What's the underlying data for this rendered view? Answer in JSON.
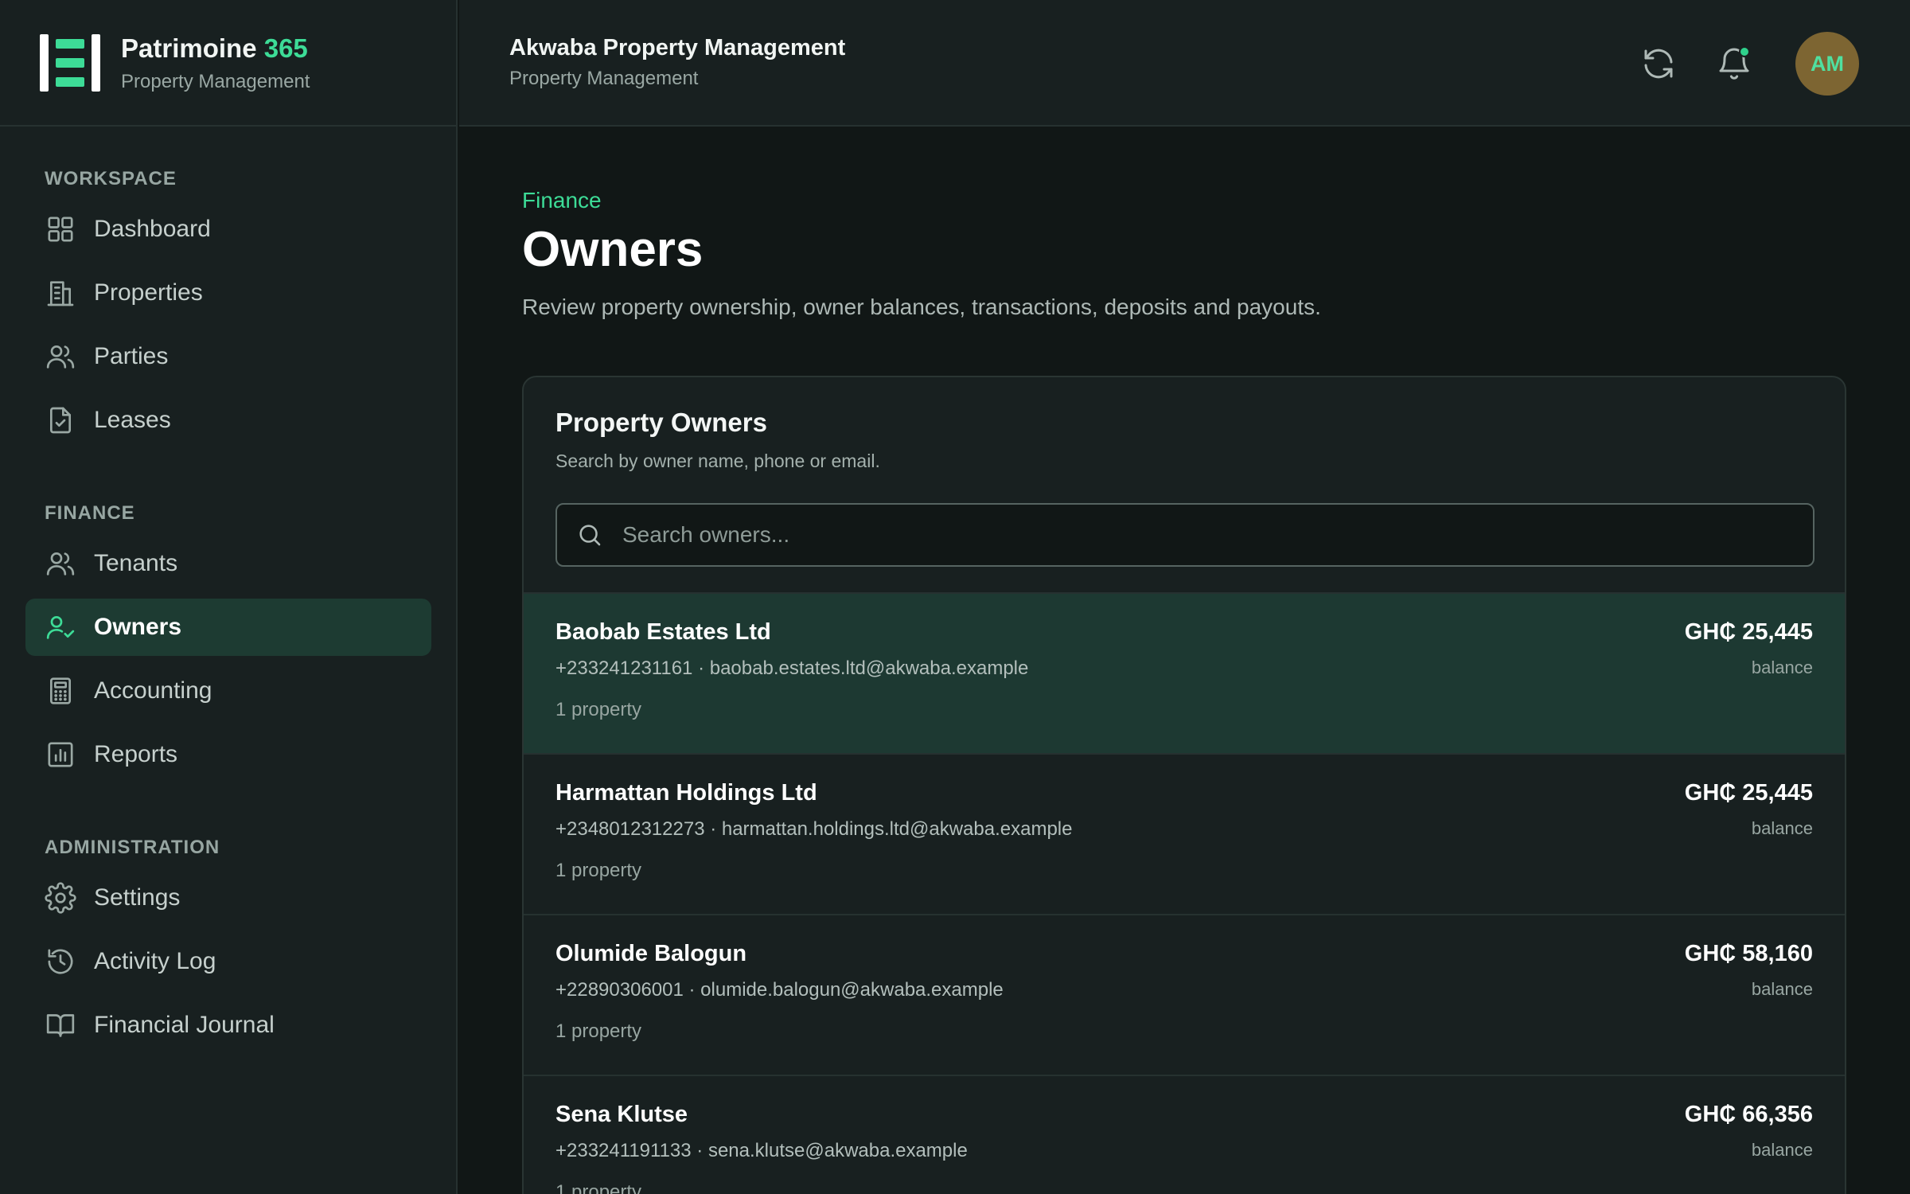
{
  "brand": {
    "name": "Patrimoine",
    "name_accent": "365",
    "subtitle": "Property Management"
  },
  "header": {
    "org_name": "Akwaba Property Management",
    "org_subtitle": "Property Management",
    "avatar_initials": "AM"
  },
  "sidebar": {
    "sections": [
      {
        "title": "WORKSPACE"
      },
      {
        "title": "FINANCE"
      },
      {
        "title": "ADMINISTRATION"
      }
    ],
    "items": [
      {
        "label": "Dashboard",
        "icon": "grid-icon"
      },
      {
        "label": "Properties",
        "icon": "building-icon"
      },
      {
        "label": "Parties",
        "icon": "users-icon"
      },
      {
        "label": "Leases",
        "icon": "file-check-icon"
      },
      {
        "label": "Tenants",
        "icon": "users-icon"
      },
      {
        "label": "Owners",
        "icon": "user-check-icon",
        "active": true
      },
      {
        "label": "Accounting",
        "icon": "calculator-icon"
      },
      {
        "label": "Reports",
        "icon": "bar-chart-icon"
      },
      {
        "label": "Settings",
        "icon": "gear-icon"
      },
      {
        "label": "Activity Log",
        "icon": "history-icon"
      },
      {
        "label": "Financial Journal",
        "icon": "book-icon"
      }
    ]
  },
  "main": {
    "section": "Finance",
    "title": "Owners",
    "description": "Review property ownership, owner balances, transactions, deposits and payouts.",
    "card": {
      "title": "Property Owners",
      "subtitle": "Search by owner name, phone or email.",
      "search_placeholder": "Search owners..."
    },
    "owners": [
      {
        "name": "Baobab Estates Ltd",
        "contact": "+233241231161 · baobab.estates.ltd@akwaba.example",
        "properties": "1 property",
        "balance": "GH₵ 25,445",
        "balance_label": "balance",
        "selected": true
      },
      {
        "name": "Harmattan Holdings Ltd",
        "contact": "+2348012312273 · harmattan.holdings.ltd@akwaba.example",
        "properties": "1 property",
        "balance": "GH₵ 25,445",
        "balance_label": "balance"
      },
      {
        "name": "Olumide Balogun",
        "contact": "+22890306001 · olumide.balogun@akwaba.example",
        "properties": "1 property",
        "balance": "GH₵ 58,160",
        "balance_label": "balance"
      },
      {
        "name": "Sena Klutse",
        "contact": "+233241191133 · sena.klutse@akwaba.example",
        "properties": "1 property",
        "balance": "GH₵ 66,356",
        "balance_label": "balance"
      }
    ]
  },
  "colors": {
    "accent": "#3ddc97",
    "background": "#111716",
    "panel": "#182020",
    "active_row": "#1d3932",
    "avatar_bg": "#7d6532"
  }
}
